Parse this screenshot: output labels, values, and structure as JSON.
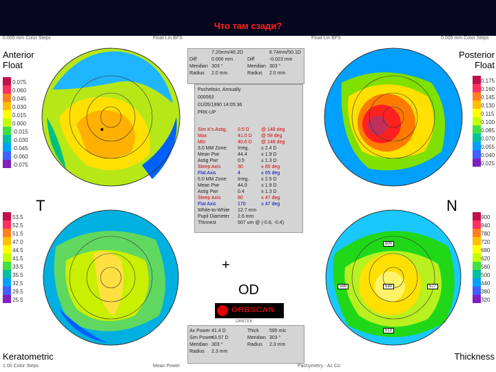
{
  "title": "Что там сзади?",
  "header": {
    "left_scale": "0.005 mm Color Steps",
    "left_reference": "Float-Lin BFS",
    "right_reference": "Float-Lin BFS",
    "right_scale": "0.005 mm Color Steps"
  },
  "quadrants": {
    "anterior": {
      "line1": "Anterior",
      "line2": "Float"
    },
    "posterior": {
      "line1": "Posterior",
      "line2": "Float"
    },
    "keratometric": {
      "label": "Keratometric",
      "sub": "1.00 Color Steps"
    },
    "thickness": {
      "label": "Thickness",
      "sub": "Pachymetry - Ac Co"
    }
  },
  "scales": {
    "anterior": [
      "0.075",
      "0.060",
      "0.045",
      "0.030",
      "0.015",
      "0.000",
      "-0.015",
      "-0.030",
      "-0.045",
      "-0.060",
      "-0.075"
    ],
    "posterior": [
      "0.175",
      "0.160",
      "0.145",
      "0.130",
      "0.115",
      "0.100",
      "0.085",
      "0.070",
      "0.055",
      "0.040",
      "0.025"
    ],
    "keratometric": [
      "53.5",
      "52.5",
      "51.5",
      "47.0",
      "44.5",
      "41.5",
      "33.5",
      "35.5",
      "32.5",
      "29.5",
      "25.5"
    ],
    "thickness": [
      "900",
      "840",
      "780",
      "720",
      "680",
      "620",
      "560",
      "500",
      "440",
      "380",
      "320"
    ]
  },
  "markers": {
    "temporal": "T",
    "nasal": "N",
    "plus": "+",
    "eye": "OD",
    "logo": "ORBSCAN",
    "logo_sub": "ORBTEK"
  },
  "thickness_points": [
    "500",
    "599",
    "530",
    "577",
    "513"
  ],
  "panel_top": {
    "left": [
      [
        "",
        "7.20mm/46.2D"
      ],
      [
        "Diff",
        "0.000 mm"
      ],
      [
        "Meridian",
        "303 °"
      ],
      [
        "Radius",
        "2.0 mm"
      ]
    ],
    "right": [
      [
        "",
        "6.74mm/50.1D"
      ],
      [
        "Diff",
        "-0.023 mm"
      ],
      [
        "Meridian",
        "303 °"
      ],
      [
        "Radius",
        "2.0 mm"
      ]
    ]
  },
  "patient": [
    "Pocheltsin, Annually",
    "000063",
    "01/05/1990 14:05:36",
    "PRK-UP"
  ],
  "sim_k": [
    [
      "Sim K's Astig.",
      "0.5 D",
      "@ 148 deg",
      "red"
    ],
    [
      "Max",
      "41.0 D",
      "@ 58 deg",
      "red"
    ],
    [
      "Min",
      "40.6 D",
      "@ 148 deg",
      "red"
    ],
    [
      "3.0 MM Zone:",
      "Irreg.",
      "± 2.4 D",
      ""
    ],
    [
      "Mean Pwr",
      "44.4",
      "± 1.9 D",
      ""
    ],
    [
      "Astig Pwr",
      "0.5",
      "± 1.3 D",
      ""
    ],
    [
      "Steep Axis",
      "30",
      "± 65 deg",
      "red"
    ],
    [
      "Flat Axis",
      "4",
      "± 65 deg",
      "blue"
    ],
    [
      "5.0 MM Zone:",
      "Irreg.",
      "± 2.5 D",
      ""
    ],
    [
      "Mean Pwr",
      "44.0",
      "± 1.9 D",
      ""
    ],
    [
      "Astig Pwr",
      "0.4",
      "± 1.3 D",
      ""
    ],
    [
      "Steep Axis",
      "80",
      "± 47 deg",
      "red"
    ],
    [
      "Flat Axis",
      "170",
      "± 47 deg",
      "blue"
    ],
    [
      "White-to-White",
      "12.7 mm",
      "",
      ""
    ],
    [
      "Pupil Diameter",
      "2.6 mm",
      "",
      ""
    ],
    [
      "Thinnest",
      "507 um @ (-0.8, -0.4)",
      "",
      ""
    ]
  ],
  "panel_bottom": {
    "left": [
      [
        "Ax Power",
        "41.4 D"
      ],
      [
        "Sim Power",
        "43.57 D"
      ],
      [
        "Meridian",
        "303 °"
      ],
      [
        "Radius",
        "2.3 mm"
      ]
    ],
    "right": [
      [
        "Thick",
        "595 mic"
      ],
      [
        "Meridian",
        "303 °"
      ],
      [
        "Radius",
        "2.3 mm"
      ],
      [
        "",
        ""
      ]
    ]
  },
  "footer": {
    "left": "Mean Power",
    "right": "Pachymetry - Ac Co"
  }
}
